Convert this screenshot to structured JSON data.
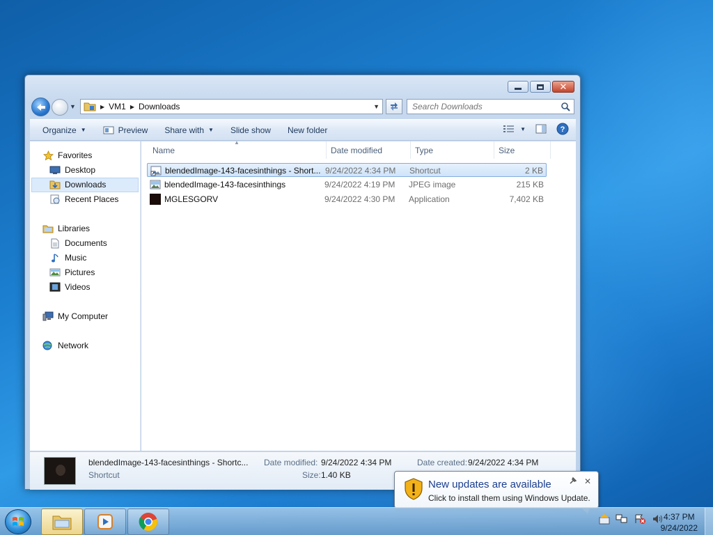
{
  "window": {
    "address": {
      "crumbs": [
        "VM1",
        "Downloads"
      ]
    },
    "search": {
      "placeholder": "Search Downloads"
    },
    "commands": {
      "organize": "Organize",
      "preview": "Preview",
      "share_with": "Share with",
      "slide_show": "Slide show",
      "new_folder": "New folder"
    },
    "nav": {
      "favorites": "Favorites",
      "desktop": "Desktop",
      "downloads": "Downloads",
      "recent_places": "Recent Places",
      "libraries": "Libraries",
      "documents": "Documents",
      "music": "Music",
      "pictures": "Pictures",
      "videos": "Videos",
      "my_computer": "My Computer",
      "network": "Network"
    },
    "columns": {
      "name": "Name",
      "date": "Date modified",
      "type": "Type",
      "size": "Size"
    },
    "files": [
      {
        "name": "blendedImage-143-facesinthings - Short...",
        "date": "9/24/2022 4:34 PM",
        "type": "Shortcut",
        "size": "2 KB",
        "icon": "shortcut-image-icon"
      },
      {
        "name": "blendedImage-143-facesinthings",
        "date": "9/24/2022 4:19 PM",
        "type": "JPEG image",
        "size": "215 KB",
        "icon": "jpeg-image-icon"
      },
      {
        "name": "MGLESGORV",
        "date": "9/24/2022 4:30 PM",
        "type": "Application",
        "size": "7,402 KB",
        "icon": "application-icon"
      }
    ],
    "details": {
      "name": "blendedImage-143-facesinthings - Shortc...",
      "type": "Shortcut",
      "modified_label": "Date modified:",
      "modified_value": "9/24/2022 4:34 PM",
      "created_label": "Date created:",
      "created_value": "9/24/2022 4:34 PM",
      "size_label": "Size:",
      "size_value": "1.40 KB"
    }
  },
  "balloon": {
    "title": "New updates are available",
    "body": "Click to install them using Windows Update."
  },
  "clock": {
    "time": "4:37 PM",
    "date": "9/24/2022"
  },
  "colors": {
    "selection": "#cfe3f9",
    "accent": "#1b3e8f",
    "close_button": "#c4452c"
  }
}
